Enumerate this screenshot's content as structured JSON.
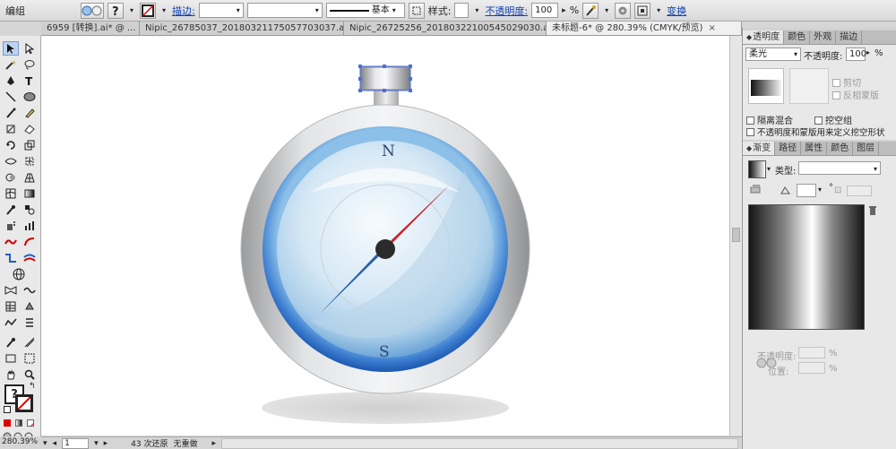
{
  "control_bar": {
    "mode_label": "编组",
    "stroke_link": "描边:",
    "style_label": "基本",
    "style_text": "样式:",
    "opacity_link": "不透明度:",
    "opacity_value": "100",
    "opacity_unit": "%",
    "transform_link": "变换"
  },
  "tabs": [
    {
      "label": "6959 [转换].ai* @ ..."
    },
    {
      "label": "Nipic_26785037_20180321175057703037.ai*"
    },
    {
      "label": "Nipic_26725256_20180322100545029030.ai*"
    },
    {
      "label": "未标题-6* @ 280.39% (CMYK/预览)"
    }
  ],
  "tab_close": "×",
  "tools_question": "?",
  "compass": {
    "north_label": "N",
    "south_label": "S"
  },
  "transparency_panel": {
    "tabs": [
      "透明度",
      "颜色",
      "外观",
      "描边"
    ],
    "blend_mode": "柔光",
    "opacity_label": "不透明度:",
    "opacity_value": "100",
    "opacity_unit": "%",
    "clip_label": "剪切",
    "invert_mask_label": "反相蒙版",
    "isolate_blend_label": "隔离混合",
    "knockout_group_label": "挖空组",
    "opacity_mask_label": "不透明度和蒙版用来定义挖空形状"
  },
  "gradient_panel": {
    "tabs": [
      "渐变",
      "路径",
      "属性",
      "颜色",
      "图层"
    ],
    "type_label": "类型:",
    "angle_unit": "°",
    "opacity_label": "不透明度:",
    "location_label": "位置:",
    "unit": "%"
  },
  "status_bar": {
    "zoom": "280.39%",
    "page": "1",
    "undo_text": "43 次还原",
    "redo_text": "无重做"
  }
}
